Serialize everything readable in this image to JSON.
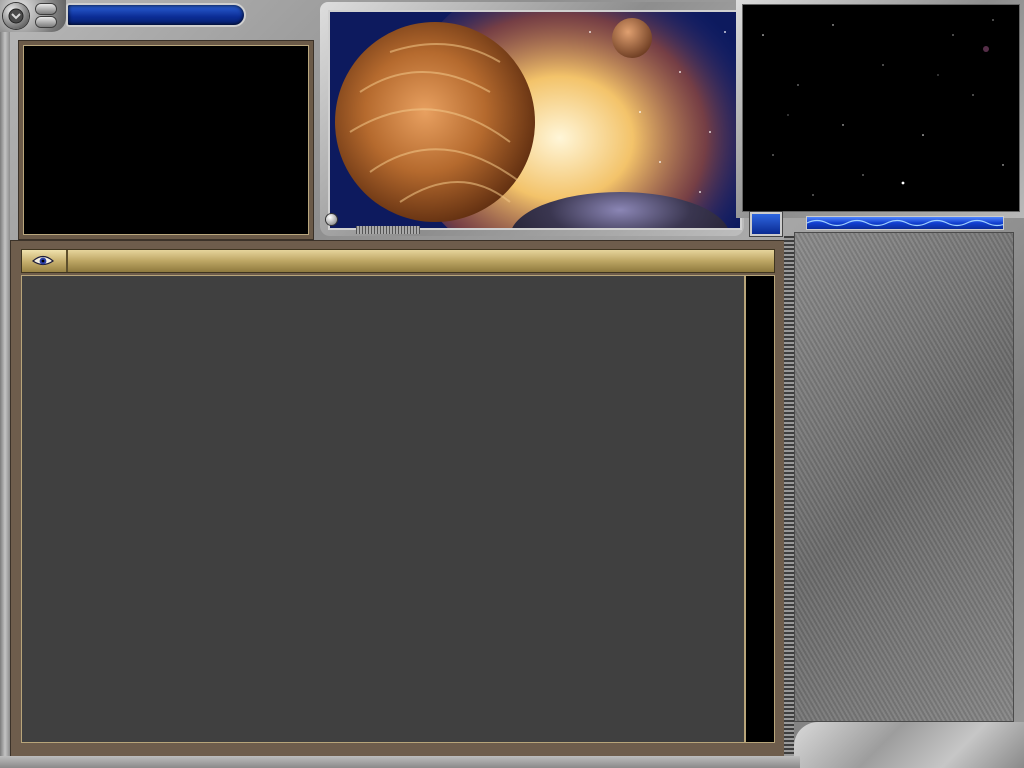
{
  "window": {
    "title": ""
  },
  "header": {
    "tab_title": ""
  },
  "colors": {
    "accent_blue": "#0b2c94",
    "panel_brown": "#6e5d4c",
    "header_gold": "#bda664",
    "log_background": "#404040",
    "metal": "#9a9a9a"
  },
  "icons": {
    "system_button": "chevron-down-icon",
    "log_tab": "eye-icon"
  }
}
